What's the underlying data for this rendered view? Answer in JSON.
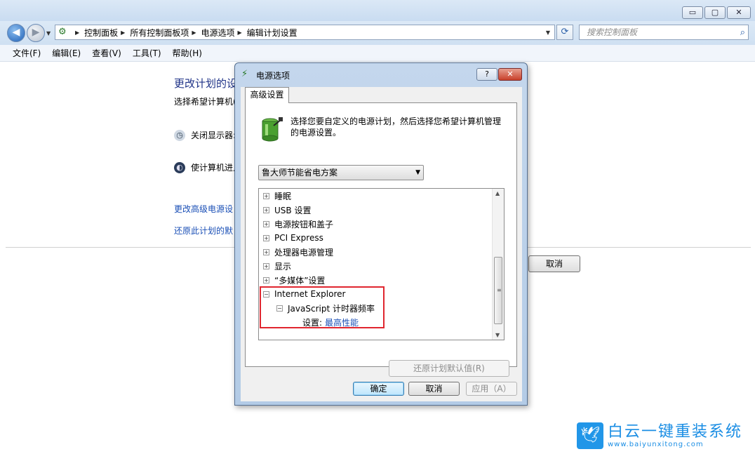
{
  "window": {
    "minimize": "▭",
    "maximize": "▢",
    "close": "✕"
  },
  "nav": {
    "back": "◀",
    "forward": "▶",
    "breadcrumbs": [
      "控制面板",
      "所有控制面板项",
      "电源选项",
      "编辑计划设置"
    ],
    "search_placeholder": "搜索控制面板"
  },
  "menu": [
    "文件(F)",
    "编辑(E)",
    "查看(V)",
    "工具(T)",
    "帮助(H)"
  ],
  "background": {
    "title": "更改计划的设",
    "subtitle": "选择希望计算机(",
    "row1": "关闭显示器:",
    "row2": "使计算机进入",
    "link1": "更改高级电源设",
    "link2": "还原此计划的默",
    "cancel": "取消"
  },
  "dialog": {
    "title": "电源选项",
    "help": "?",
    "close": "✕",
    "tab": "高级设置",
    "description": "选择您要自定义的电源计划，然后选择您希望计算机管理的电源设置。",
    "plan": "鲁大师节能省电方案",
    "tree": [
      {
        "label": "睡眠",
        "expanded": false,
        "level": 0
      },
      {
        "label": "USB 设置",
        "expanded": false,
        "level": 0
      },
      {
        "label": "电源按钮和盖子",
        "expanded": false,
        "level": 0
      },
      {
        "label": "PCI Express",
        "expanded": false,
        "level": 0
      },
      {
        "label": "处理器电源管理",
        "expanded": false,
        "level": 0
      },
      {
        "label": "显示",
        "expanded": false,
        "level": 0
      },
      {
        "label": "“多媒体”设置",
        "expanded": false,
        "level": 0
      },
      {
        "label": "Internet Explorer",
        "expanded": true,
        "level": 0
      },
      {
        "label": "JavaScript 计时器频率",
        "expanded": true,
        "level": 1
      }
    ],
    "setting_label": "设置:",
    "setting_value": "最高性能",
    "restore_button": "还原计划默认值(R)",
    "ok": "确定",
    "cancel": "取消",
    "apply": "应用（A）"
  },
  "watermark": {
    "cn": "白云一键重装系统",
    "en": "www.baiyunxitong.com"
  },
  "colors": {
    "highlight_border": "#e0262f",
    "link": "#1a4fb6"
  }
}
